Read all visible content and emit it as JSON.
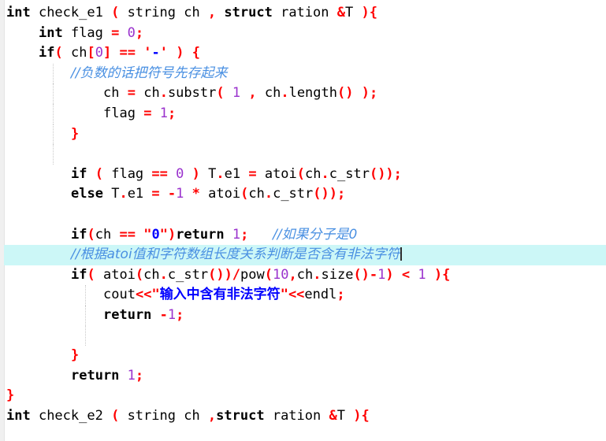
{
  "editor": {
    "language": "C++",
    "background_color": "#ffffff",
    "gutter_color": "#f0f0f0",
    "highlight_line_color": "#ccf7f7",
    "colors": {
      "keyword": "#000000",
      "identifier": "#000000",
      "operator": "#ff0000",
      "number": "#9a32cd",
      "string": "#0000ff",
      "string_quote": "#ff0000",
      "comment": "#4a90e2"
    },
    "caret": {
      "visible": true,
      "line_index": 13
    }
  },
  "code": {
    "lines": [
      {
        "index": 0,
        "indent": 0,
        "highlight": false,
        "tokens": [
          {
            "t": "kw",
            "v": "int"
          },
          {
            "t": "id",
            "v": " check_e1 "
          },
          {
            "t": "op",
            "v": "("
          },
          {
            "t": "id",
            "v": " string ch "
          },
          {
            "t": "op",
            "v": ","
          },
          {
            "t": "id",
            "v": " "
          },
          {
            "t": "kw",
            "v": "struct"
          },
          {
            "t": "id",
            "v": " ration "
          },
          {
            "t": "op",
            "v": "&"
          },
          {
            "t": "id",
            "v": "T "
          },
          {
            "t": "op",
            "v": "){"
          }
        ]
      },
      {
        "index": 1,
        "indent": 1,
        "highlight": false,
        "tokens": [
          {
            "t": "kw",
            "v": "int"
          },
          {
            "t": "id",
            "v": " flag "
          },
          {
            "t": "op",
            "v": "="
          },
          {
            "t": "id",
            "v": " "
          },
          {
            "t": "num",
            "v": "0"
          },
          {
            "t": "op",
            "v": ";"
          }
        ]
      },
      {
        "index": 2,
        "indent": 1,
        "highlight": false,
        "tokens": [
          {
            "t": "kw",
            "v": "if"
          },
          {
            "t": "op",
            "v": "("
          },
          {
            "t": "id",
            "v": " ch"
          },
          {
            "t": "op",
            "v": "["
          },
          {
            "t": "num",
            "v": "0"
          },
          {
            "t": "op",
            "v": "]"
          },
          {
            "t": "id",
            "v": " "
          },
          {
            "t": "op",
            "v": "=="
          },
          {
            "t": "id",
            "v": " "
          },
          {
            "t": "quo",
            "v": "'"
          },
          {
            "t": "str",
            "v": "-"
          },
          {
            "t": "quo",
            "v": "'"
          },
          {
            "t": "id",
            "v": " "
          },
          {
            "t": "op",
            "v": ")"
          },
          {
            "t": "id",
            "v": " "
          },
          {
            "t": "op",
            "v": "{"
          }
        ]
      },
      {
        "index": 3,
        "indent": 2,
        "highlight": false,
        "guides": [
          1
        ],
        "tokens": [
          {
            "t": "cmt",
            "v": "//负数的话把符号先存起来"
          }
        ]
      },
      {
        "index": 4,
        "indent": 3,
        "highlight": false,
        "guides": [
          1
        ],
        "tokens": [
          {
            "t": "id",
            "v": "ch "
          },
          {
            "t": "op",
            "v": "="
          },
          {
            "t": "id",
            "v": " ch"
          },
          {
            "t": "op",
            "v": "."
          },
          {
            "t": "id",
            "v": "substr"
          },
          {
            "t": "op",
            "v": "("
          },
          {
            "t": "id",
            "v": " "
          },
          {
            "t": "num",
            "v": "1"
          },
          {
            "t": "id",
            "v": " "
          },
          {
            "t": "op",
            "v": ","
          },
          {
            "t": "id",
            "v": " ch"
          },
          {
            "t": "op",
            "v": "."
          },
          {
            "t": "id",
            "v": "length"
          },
          {
            "t": "op",
            "v": "()"
          },
          {
            "t": "id",
            "v": " "
          },
          {
            "t": "op",
            "v": ");"
          }
        ]
      },
      {
        "index": 5,
        "indent": 3,
        "highlight": false,
        "guides": [
          1
        ],
        "tokens": [
          {
            "t": "id",
            "v": "flag "
          },
          {
            "t": "op",
            "v": "="
          },
          {
            "t": "id",
            "v": " "
          },
          {
            "t": "num",
            "v": "1"
          },
          {
            "t": "op",
            "v": ";"
          }
        ]
      },
      {
        "index": 6,
        "indent": 2,
        "highlight": false,
        "guides": [
          1
        ],
        "tokens": [
          {
            "t": "op",
            "v": "}"
          }
        ]
      },
      {
        "index": 7,
        "indent": 0,
        "highlight": false,
        "guides": [
          1
        ],
        "tokens": []
      },
      {
        "index": 8,
        "indent": 2,
        "highlight": false,
        "guides": [],
        "tokens": [
          {
            "t": "kw",
            "v": "if"
          },
          {
            "t": "id",
            "v": " "
          },
          {
            "t": "op",
            "v": "("
          },
          {
            "t": "id",
            "v": " flag "
          },
          {
            "t": "op",
            "v": "=="
          },
          {
            "t": "id",
            "v": " "
          },
          {
            "t": "num",
            "v": "0"
          },
          {
            "t": "id",
            "v": " "
          },
          {
            "t": "op",
            "v": ")"
          },
          {
            "t": "id",
            "v": " T"
          },
          {
            "t": "op",
            "v": "."
          },
          {
            "t": "id",
            "v": "e1 "
          },
          {
            "t": "op",
            "v": "="
          },
          {
            "t": "id",
            "v": " atoi"
          },
          {
            "t": "op",
            "v": "("
          },
          {
            "t": "id",
            "v": "ch"
          },
          {
            "t": "op",
            "v": "."
          },
          {
            "t": "id",
            "v": "c_str"
          },
          {
            "t": "op",
            "v": "());"
          }
        ]
      },
      {
        "index": 9,
        "indent": 2,
        "highlight": false,
        "tokens": [
          {
            "t": "kw",
            "v": "else"
          },
          {
            "t": "id",
            "v": " T"
          },
          {
            "t": "op",
            "v": "."
          },
          {
            "t": "id",
            "v": "e1 "
          },
          {
            "t": "op",
            "v": "="
          },
          {
            "t": "id",
            "v": " "
          },
          {
            "t": "op",
            "v": "-"
          },
          {
            "t": "num",
            "v": "1"
          },
          {
            "t": "id",
            "v": " "
          },
          {
            "t": "op",
            "v": "*"
          },
          {
            "t": "id",
            "v": " atoi"
          },
          {
            "t": "op",
            "v": "("
          },
          {
            "t": "id",
            "v": "ch"
          },
          {
            "t": "op",
            "v": "."
          },
          {
            "t": "id",
            "v": "c_str"
          },
          {
            "t": "op",
            "v": "());"
          }
        ]
      },
      {
        "index": 10,
        "indent": 0,
        "highlight": false,
        "tokens": []
      },
      {
        "index": 11,
        "indent": 2,
        "highlight": false,
        "tokens": [
          {
            "t": "kw",
            "v": "if"
          },
          {
            "t": "op",
            "v": "("
          },
          {
            "t": "id",
            "v": "ch "
          },
          {
            "t": "op",
            "v": "=="
          },
          {
            "t": "id",
            "v": " "
          },
          {
            "t": "quo",
            "v": "\""
          },
          {
            "t": "str",
            "v": "0"
          },
          {
            "t": "quo",
            "v": "\""
          },
          {
            "t": "op",
            "v": ")"
          },
          {
            "t": "kw",
            "v": "return"
          },
          {
            "t": "id",
            "v": " "
          },
          {
            "t": "num",
            "v": "1"
          },
          {
            "t": "op",
            "v": ";"
          },
          {
            "t": "id",
            "v": "   "
          },
          {
            "t": "cmt",
            "v": "//如果分子是0"
          }
        ]
      },
      {
        "index": 12,
        "indent": 2,
        "highlight": true,
        "caret": true,
        "tokens": [
          {
            "t": "cmt",
            "v": "//根据atoi值和字符数组长度关系判断是否含有非法字符"
          }
        ]
      },
      {
        "index": 13,
        "indent": 2,
        "highlight": false,
        "tokens": [
          {
            "t": "kw",
            "v": "if"
          },
          {
            "t": "op",
            "v": "("
          },
          {
            "t": "id",
            "v": " atoi"
          },
          {
            "t": "op",
            "v": "("
          },
          {
            "t": "id",
            "v": "ch"
          },
          {
            "t": "op",
            "v": "."
          },
          {
            "t": "id",
            "v": "c_str"
          },
          {
            "t": "op",
            "v": "())/"
          },
          {
            "t": "id",
            "v": "pow"
          },
          {
            "t": "op",
            "v": "("
          },
          {
            "t": "num",
            "v": "10"
          },
          {
            "t": "op",
            "v": ","
          },
          {
            "t": "id",
            "v": "ch"
          },
          {
            "t": "op",
            "v": "."
          },
          {
            "t": "id",
            "v": "size"
          },
          {
            "t": "op",
            "v": "()-"
          },
          {
            "t": "num",
            "v": "1"
          },
          {
            "t": "op",
            "v": ")"
          },
          {
            "t": "id",
            "v": " "
          },
          {
            "t": "op",
            "v": "<"
          },
          {
            "t": "id",
            "v": " "
          },
          {
            "t": "num",
            "v": "1"
          },
          {
            "t": "id",
            "v": " "
          },
          {
            "t": "op",
            "v": "){"
          }
        ]
      },
      {
        "index": 14,
        "indent": 3,
        "highlight": false,
        "guides": [
          2
        ],
        "tokens": [
          {
            "t": "id",
            "v": "cout"
          },
          {
            "t": "op",
            "v": "<<"
          },
          {
            "t": "quo",
            "v": "\""
          },
          {
            "t": "str",
            "v": "输入中含有非法字符"
          },
          {
            "t": "quo",
            "v": "\""
          },
          {
            "t": "op",
            "v": "<<"
          },
          {
            "t": "id",
            "v": "endl"
          },
          {
            "t": "op",
            "v": ";"
          }
        ]
      },
      {
        "index": 15,
        "indent": 3,
        "highlight": false,
        "guides": [
          2
        ],
        "tokens": [
          {
            "t": "kw",
            "v": "return"
          },
          {
            "t": "id",
            "v": " "
          },
          {
            "t": "op",
            "v": "-"
          },
          {
            "t": "num",
            "v": "1"
          },
          {
            "t": "op",
            "v": ";"
          }
        ]
      },
      {
        "index": 16,
        "indent": 0,
        "highlight": false,
        "guides": [
          2
        ],
        "tokens": []
      },
      {
        "index": 17,
        "indent": 2,
        "highlight": false,
        "tokens": [
          {
            "t": "op",
            "v": "}"
          }
        ]
      },
      {
        "index": 18,
        "indent": 2,
        "highlight": false,
        "tokens": [
          {
            "t": "kw",
            "v": "return"
          },
          {
            "t": "id",
            "v": " "
          },
          {
            "t": "num",
            "v": "1"
          },
          {
            "t": "op",
            "v": ";"
          }
        ]
      },
      {
        "index": 19,
        "indent": 0,
        "highlight": false,
        "tokens": [
          {
            "t": "op",
            "v": "}"
          }
        ]
      },
      {
        "index": 20,
        "indent": 0,
        "highlight": false,
        "clipped": true,
        "tokens": [
          {
            "t": "kw",
            "v": "int"
          },
          {
            "t": "id",
            "v": " check_e2 "
          },
          {
            "t": "op",
            "v": "("
          },
          {
            "t": "id",
            "v": " string ch "
          },
          {
            "t": "op",
            "v": ","
          },
          {
            "t": "kw",
            "v": "struct"
          },
          {
            "t": "id",
            "v": " ration "
          },
          {
            "t": "op",
            "v": "&"
          },
          {
            "t": "id",
            "v": "T "
          },
          {
            "t": "op",
            "v": "){"
          }
        ]
      }
    ]
  }
}
